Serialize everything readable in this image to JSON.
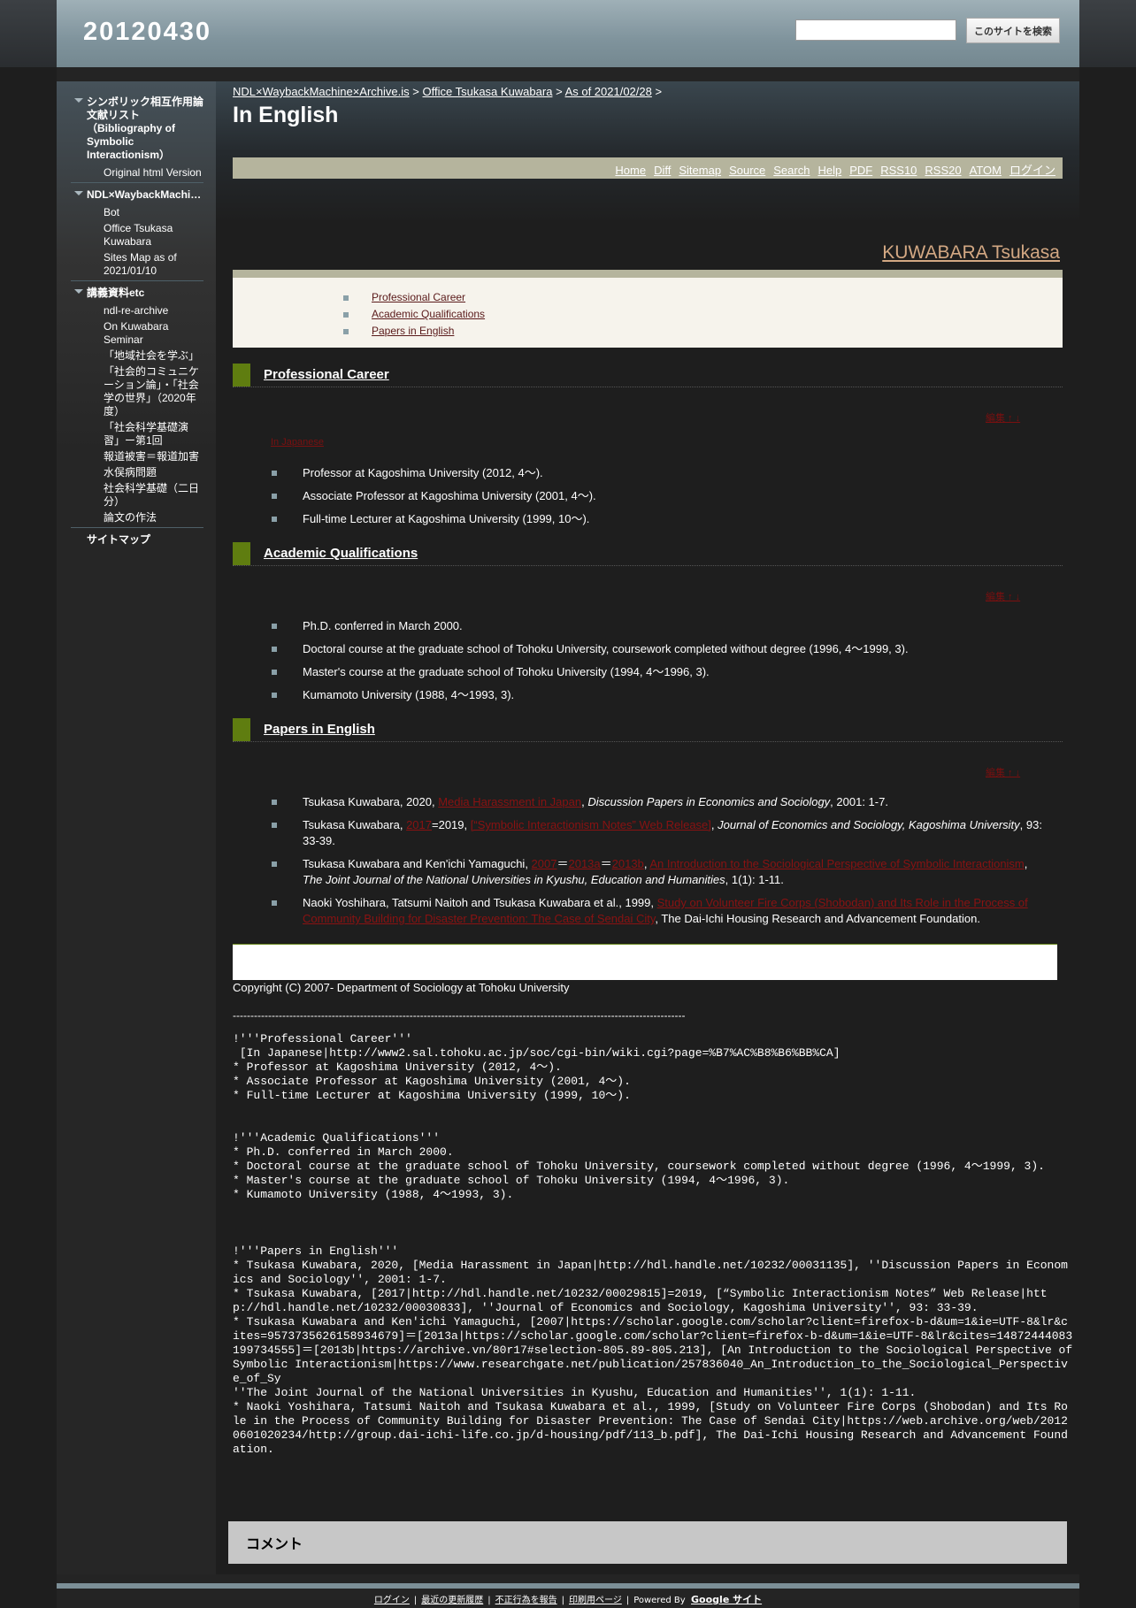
{
  "site": {
    "title": "20120430"
  },
  "search": {
    "placeholder": "",
    "button_label": "このサイトを検索"
  },
  "sidebar": {
    "groups": [
      {
        "title": "シンボリック相互作用論文献リスト（Bibliography of Symbolic Interactionism）",
        "items": [
          "Original html Version"
        ]
      },
      {
        "title": "NDL×WaybackMachi…",
        "items": [
          "Bot",
          "Office Tsukasa Kuwabara",
          "Sites Map as of 2021/01/10"
        ]
      },
      {
        "title": "講義資料etc",
        "items": [
          "ndl-re-archive",
          "On Kuwabara Seminar",
          "「地域社会を学ぶ」",
          "「社会的コミュニケーション論」・「社会学の世界」（2020年度）",
          "「社会科学基礎演習」ー第1回",
          "報道被害＝報道加害",
          "水俣病問題",
          "社会科学基礎（二日分）",
          "論文の作法"
        ]
      }
    ],
    "sitemap": "サイトマップ"
  },
  "breadcrumb": {
    "item1": "NDL×WaybackMachine×Archive.is",
    "item2": "Office Tsukasa Kuwabara",
    "item3": "As of 2021/02/28",
    "sep": ">"
  },
  "page": {
    "title": "In English"
  },
  "toolbar": [
    "Home",
    "Diff",
    "Sitemap",
    "Source",
    "Search",
    "Help",
    "PDF",
    "RSS10",
    "RSS20",
    "ATOM",
    "ログイン"
  ],
  "author": {
    "name": "KUWABARA Tsukasa"
  },
  "toc": [
    "Professional Career",
    "Academic Qualifications",
    "Papers in English"
  ],
  "sections": {
    "career": {
      "title": "Professional Career",
      "edit": "編集 ↑ ↓",
      "japanese_link": "In Japanese",
      "items": [
        "Professor at Kagoshima University (2012, 4～).",
        "Associate Professor at Kagoshima University (2001, 4～).",
        "Full-time Lecturer at Kagoshima University (1999, 10～)."
      ]
    },
    "qualifications": {
      "title": "Academic Qualifications",
      "edit": "編集 ↑ ↓",
      "items": [
        "Ph.D. conferred in March 2000.",
        "Doctoral course at the graduate school of Tohoku University, coursework completed without degree (1996, 4～1999, 3).",
        "Master's course at the graduate school of Tohoku University (1994, 4～1996, 3).",
        "Kumamoto University (1988, 4～1993, 3)."
      ]
    },
    "papers": {
      "title": "Papers in English",
      "edit": "編集 ↑ ↓",
      "p1": {
        "a": "Tsukasa Kuwabara, 2020, ",
        "link": "Media Harassment in Japan",
        "b": ", ",
        "journal": "Discussion Papers in Economics and Sociology",
        "c": ", 2001: 1-7."
      },
      "p2": {
        "a": "Tsukasa Kuwabara, ",
        "link1": "2017",
        "b": "=2019, ",
        "link2": "[“Symbolic Interactionism Notes” Web Release]",
        "c": ", ",
        "journal": "Journal of Economics and Sociology, Kagoshima University",
        "d": ", 93: 33-39."
      },
      "p3": {
        "a": "Tsukasa Kuwabara and Ken'ichi Yamaguchi, ",
        "link1": "2007",
        "b": "＝",
        "link2": "2013a",
        "c": "＝",
        "link3": "2013b",
        "d": ", ",
        "link4": "An Introduction to the Sociological Perspective of Symbolic Interactionism",
        "e": ", ",
        "journal": "The Joint Journal of the National Universities in Kyushu, Education and Humanities",
        "f": ", 1(1): 1-11."
      },
      "p4": {
        "a": "Naoki Yoshihara, Tatsumi Naitoh and Tsukasa Kuwabara et al., 1999, ",
        "link": "Study on Volunteer Fire Corps (Shobodan) and Its Role in the Process of Community Building for Disaster Prevention: The Case of Sendai City",
        "b": ", The Dai-Ichi Housing Research and Advancement Foundation."
      }
    }
  },
  "copyright": "Copyright (C) 2007- Department of Sociology at Tohoku University",
  "divider": "--------------------------------------------------------------------------------------------------------------------------------",
  "source_text": "!'''Professional Career'''\n [In Japanese|http://www2.sal.tohoku.ac.jp/soc/cgi-bin/wiki.cgi?page=%B7%AC%B8%B6%BB%CA]\n* Professor at Kagoshima University (2012, 4～).\n* Associate Professor at Kagoshima University (2001, 4～).\n* Full-time Lecturer at Kagoshima University (1999, 10～).\n\n\n!'''Academic Qualifications'''\n* Ph.D. conferred in March 2000.\n* Doctoral course at the graduate school of Tohoku University, coursework completed without degree (1996, 4～1999, 3).\n* Master's course at the graduate school of Tohoku University (1994, 4～1996, 3).\n* Kumamoto University (1988, 4～1993, 3).\n\n\n\n!'''Papers in English'''\n* Tsukasa Kuwabara, 2020, [Media Harassment in Japan|http://hdl.handle.net/10232/00031135], ''Discussion Papers in Economics and Sociology'', 2001: 1-7.\n* Tsukasa Kuwabara, [2017|http://hdl.handle.net/10232/00029815]=2019, [“Symbolic Interactionism Notes” Web Release|http://hdl.handle.net/10232/00030833], ''Journal of Economics and Sociology, Kagoshima University'', 93: 33-39.\n* Tsukasa Kuwabara and Ken'ichi Yamaguchi, [2007|https://scholar.google.com/scholar?client=firefox-b-d&um=1&ie=UTF-8&lr&cites=9573735626158934679]＝[2013a|https://scholar.google.com/scholar?client=firefox-b-d&um=1&ie=UTF-8&lr&cites=14872444083199734555]＝[2013b|https://archive.vn/80r17#selection-805.89-805.213], [An Introduction to the Sociological Perspective of Symbolic Interactionism|https://www.researchgate.net/publication/257836040_An_Introduction_to_the_Sociological_Perspective_of_Sy\n''The Joint Journal of the National Universities in Kyushu, Education and Humanities'', 1(1): 1-11.\n* Naoki Yoshihara, Tatsumi Naitoh and Tsukasa Kuwabara et al., 1999, [Study on Volunteer Fire Corps (Shobodan) and Its Role in the Process of Community Building for Disaster Prevention: The Case of Sendai City|https://web.archive.org/web/20120601020234/http://group.dai-ichi-life.co.jp/d-housing/pdf/113_b.pdf], The Dai-Ichi Housing Research and Advancement Foundation.",
  "comment": {
    "title": "コメント"
  },
  "footer": {
    "login": "ログイン",
    "recent": "最近の更新履歴",
    "report": "不正行為を報告",
    "print": "印刷用ページ",
    "powered": "Powered By",
    "google": "Google サイト",
    "sep": "|"
  }
}
